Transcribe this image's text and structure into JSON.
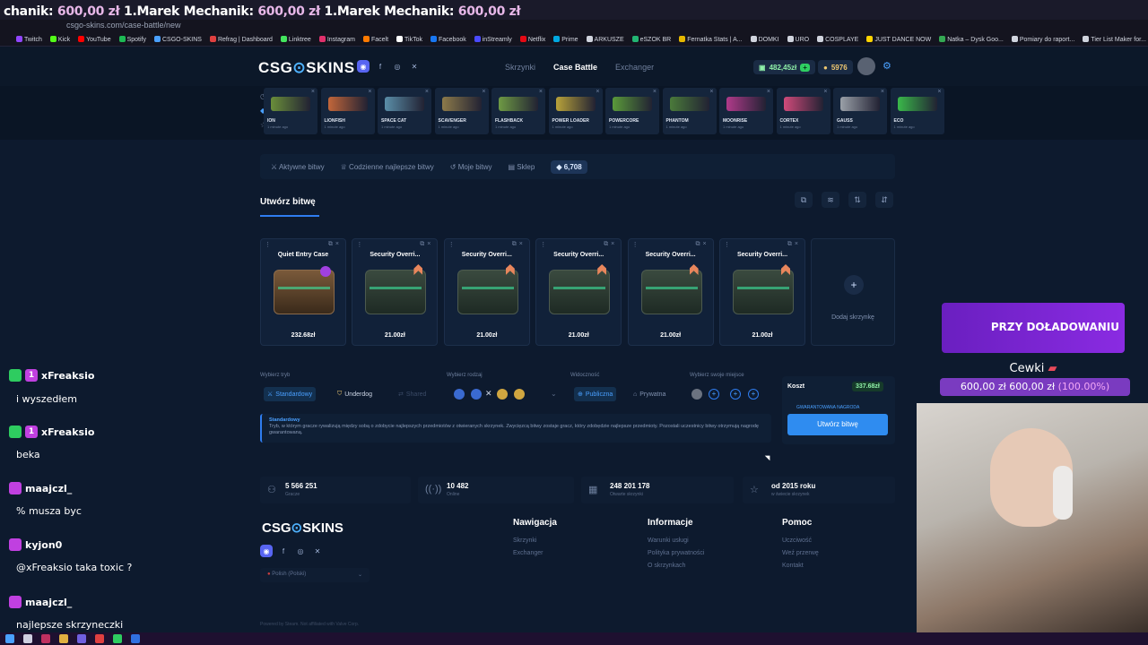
{
  "stream": {
    "ticker": [
      {
        "name": "chanik:",
        "amount": "600,00 zł"
      },
      {
        "name": "1.Marek Mechanik:",
        "amount": "600,00 zł"
      },
      {
        "name": "1.Marek Mechanik:",
        "amount": "600,00 zł"
      }
    ],
    "chat": [
      {
        "user": "xFreaksio",
        "badge": "1",
        "msg": "i wyszedłem"
      },
      {
        "user": "xFreaksio",
        "badge": "1",
        "msg": "beka"
      },
      {
        "user": "maajczl_",
        "msg": "% musza byc"
      },
      {
        "user": "kyjon0",
        "msg": "@xFreaksio taka toxic ?"
      },
      {
        "user": "maajczl_",
        "msg": "najlepsze skrzyneczki"
      }
    ],
    "promo_text": "PRZY DOŁADOWANIU",
    "goal_title": "Cewki",
    "goal_current": "600,00 zł",
    "goal_target": "600,00 zł",
    "goal_percent": "(100.00%)"
  },
  "browser": {
    "url": "csgo-skins.com/case-battle/new",
    "bookmarks": [
      "Twitch",
      "Kick",
      "YouTube",
      "Spotify",
      "CSGO-SKINS",
      "Refrag | Dashboard",
      "Linktree",
      "Instagram",
      "Facelt",
      "TikTok",
      "Facebook",
      "inStreamly",
      "Netflix",
      "Prime",
      "ARKUSZE",
      "eSZOK BR",
      "Fernatka Stats | A...",
      "DOMKI",
      "URO",
      "COSPLAYE",
      "JUST DANCE NOW",
      "Natka – Dysk Goo...",
      "Pomiary do raport...",
      "Tier List Maker for..."
    ]
  },
  "site": {
    "logo_left": "CSG",
    "logo_right": "SKINS",
    "nav": [
      "Skrzynki",
      "Case Battle",
      "Exchanger"
    ],
    "balance": "482,45zł",
    "coins": "5976",
    "carousel": [
      {
        "name": "ION",
        "color": "#6a8e3a"
      },
      {
        "name": "LIONFISH",
        "color": "#c2663a"
      },
      {
        "name": "SPACE CAT",
        "color": "#5a8ea8"
      },
      {
        "name": "SCAVENGER",
        "color": "#8c7a4a"
      },
      {
        "name": "FLASHBACK",
        "color": "#6e9a44"
      },
      {
        "name": "POWER LOADER",
        "color": "#b8a23a"
      },
      {
        "name": "POWERCORE",
        "color": "#5a9a3a"
      },
      {
        "name": "PHANTOM",
        "color": "#4a7a3a"
      },
      {
        "name": "MOONRISE",
        "color": "#b03a8a"
      },
      {
        "name": "CORTEX",
        "color": "#d04a7a"
      },
      {
        "name": "GAUSS",
        "color": "#9aa0a8"
      },
      {
        "name": "ECO",
        "color": "#3ab84a"
      }
    ],
    "carousel_sub": "1 minute ago",
    "filters": [
      "Aktywne bitwy",
      "Codzienne najlepsze bitwy",
      "Moje bitwy",
      "Sklep"
    ],
    "filter_coins": "6,708",
    "create_title": "Utwórz bitwę",
    "cases": [
      {
        "name": "Quiet Entry Case",
        "price": "232.68zł"
      },
      {
        "name": "Security Overri...",
        "price": "21.00zł"
      },
      {
        "name": "Security Overri...",
        "price": "21.00zł"
      },
      {
        "name": "Security Overri...",
        "price": "21.00zł"
      },
      {
        "name": "Security Overri...",
        "price": "21.00zł"
      },
      {
        "name": "Security Overri...",
        "price": "21.00zł"
      }
    ],
    "add_case": "Dodaj skrzynkę",
    "labels": {
      "mode": "Wybierz tryb",
      "type": "Wybierz rodzaj",
      "visibility": "Widoczność",
      "place": "Wybierz swoje miejsce"
    },
    "modes": [
      "Standardowy",
      "Underdog",
      "Shared"
    ],
    "visibility": [
      "Publiczna",
      "Prywatna"
    ],
    "cost_label": "Koszt",
    "cost_value": "337.68zł",
    "guarantee": "GWARANTOWANA NAGRODA",
    "create_button": "Utwórz bitwę",
    "desc_title": "Standardowy",
    "desc_text": "Tryb, w którym gracze rywalizują między sobą o zdobycie najlepszych przedmiotów z otwieranych skrzynek. Zwycięzcą bitwy zostaje gracz, który zdobędzie najlepsze przedmioty. Pozostali uczestnicy bitwy otrzymują nagrodę gwarantowaną.",
    "stats": [
      {
        "value": "5 566 251",
        "label": "Gracze"
      },
      {
        "value": "10 482",
        "label": "Online"
      },
      {
        "value": "248 201 178",
        "label": "Otwarte skrzynki"
      },
      {
        "value": "od 2015 roku",
        "label": "w świecie skrzynek"
      }
    ],
    "footer": {
      "nav_title": "Nawigacja",
      "nav": [
        "Skrzynki",
        "Exchanger"
      ],
      "info_title": "Informacje",
      "info": [
        "Warunki usługi",
        "Polityka prywatności",
        "O skrzynkach"
      ],
      "help_title": "Pomoc",
      "help": [
        "Uczciwość",
        "Weź przerwę",
        "Kontakt"
      ],
      "language": "Polish (Polski)",
      "powered": "Powered by Steam. Not affiliated with Valve Corp."
    }
  }
}
